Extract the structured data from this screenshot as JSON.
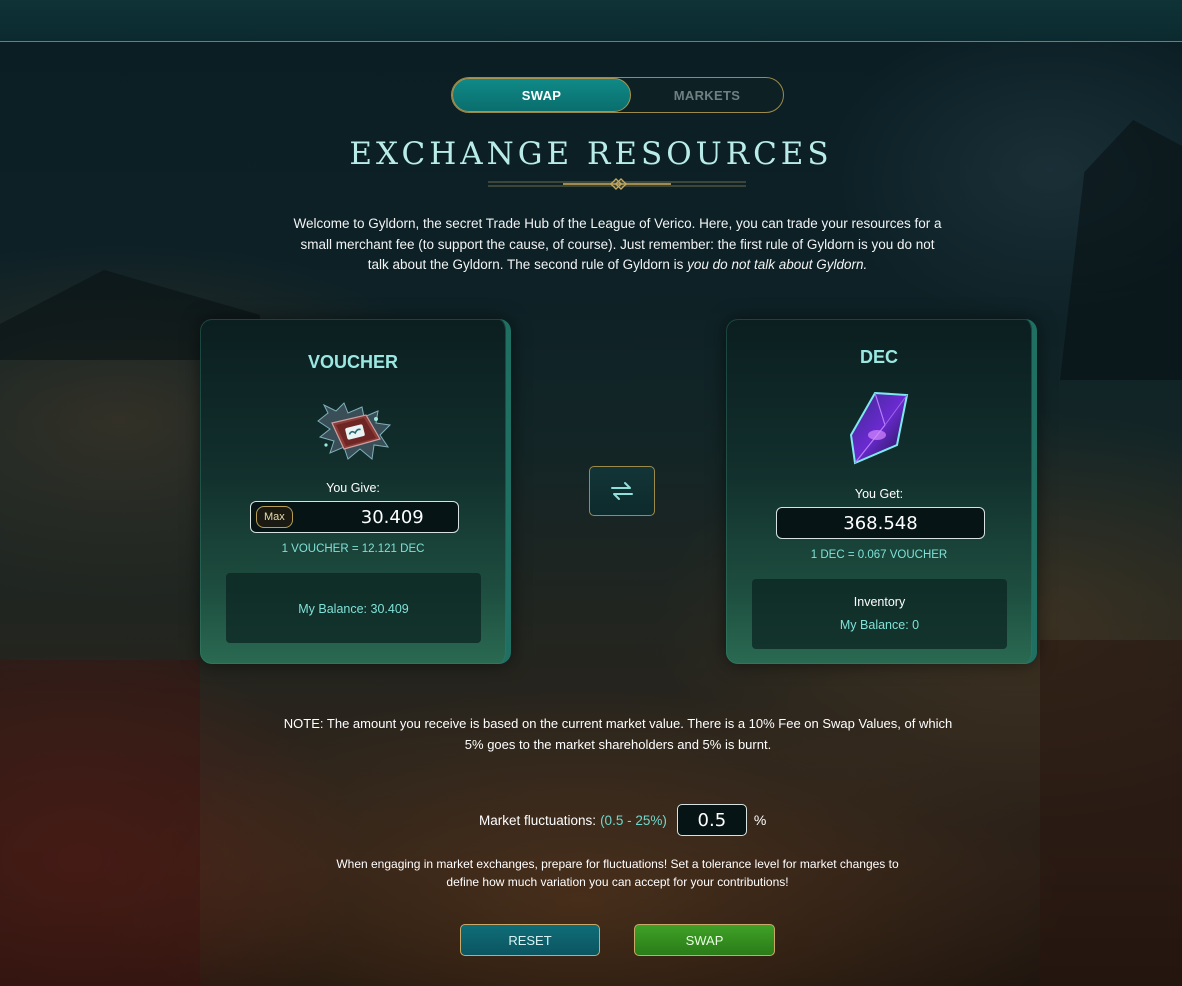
{
  "tabs": [
    {
      "label": "SWAP",
      "active": true
    },
    {
      "label": "MARKETS",
      "active": false
    }
  ],
  "title": "EXCHANGE RESOURCES",
  "intro": {
    "text": "Welcome to Gyldorn, the secret Trade Hub of the League of Verico. Here, you can trade your resources for a small merchant fee (to support the cause, of course). Just remember: the first rule of Gyldorn is you do not talk about the Gyldorn. The second rule of Gyldorn is ",
    "emphasis": "you do not talk about Gyldorn."
  },
  "give": {
    "resource": "VOUCHER",
    "icon": "voucher-book-icon",
    "label": "You Give:",
    "max_label": "Max",
    "amount": "30.409",
    "rate": "1 VOUCHER = 12.121 DEC",
    "balance": "My Balance: 30.409"
  },
  "get": {
    "resource": "DEC",
    "icon": "dec-crystal-icon",
    "label": "You Get:",
    "amount": "368.548",
    "rate": "1 DEC = 0.067 VOUCHER",
    "inventory_label": "Inventory",
    "balance": "My Balance: 0"
  },
  "swap_direction_icon": "swap-arrows-icon",
  "note": "NOTE: The amount you receive is based on the current market value. There is a 10% Fee on Swap Values, of which 5% goes to the market shareholders and 5% is burnt.",
  "fluctuation": {
    "label": "Market fluctuations:",
    "range": "(0.5 - 25%)",
    "value": "0.5",
    "unit": "%"
  },
  "help": "When engaging in market exchanges, prepare for fluctuations! Set a tolerance level for market changes to define how much variation you can accept for your contributions!",
  "buttons": {
    "reset": "RESET",
    "swap": "SWAP"
  },
  "colors": {
    "accent_teal": "#0f8a88",
    "gold_border": "#9c8a4a",
    "swap_green": "#3fa127",
    "text_teal": "#7fe2d8"
  }
}
